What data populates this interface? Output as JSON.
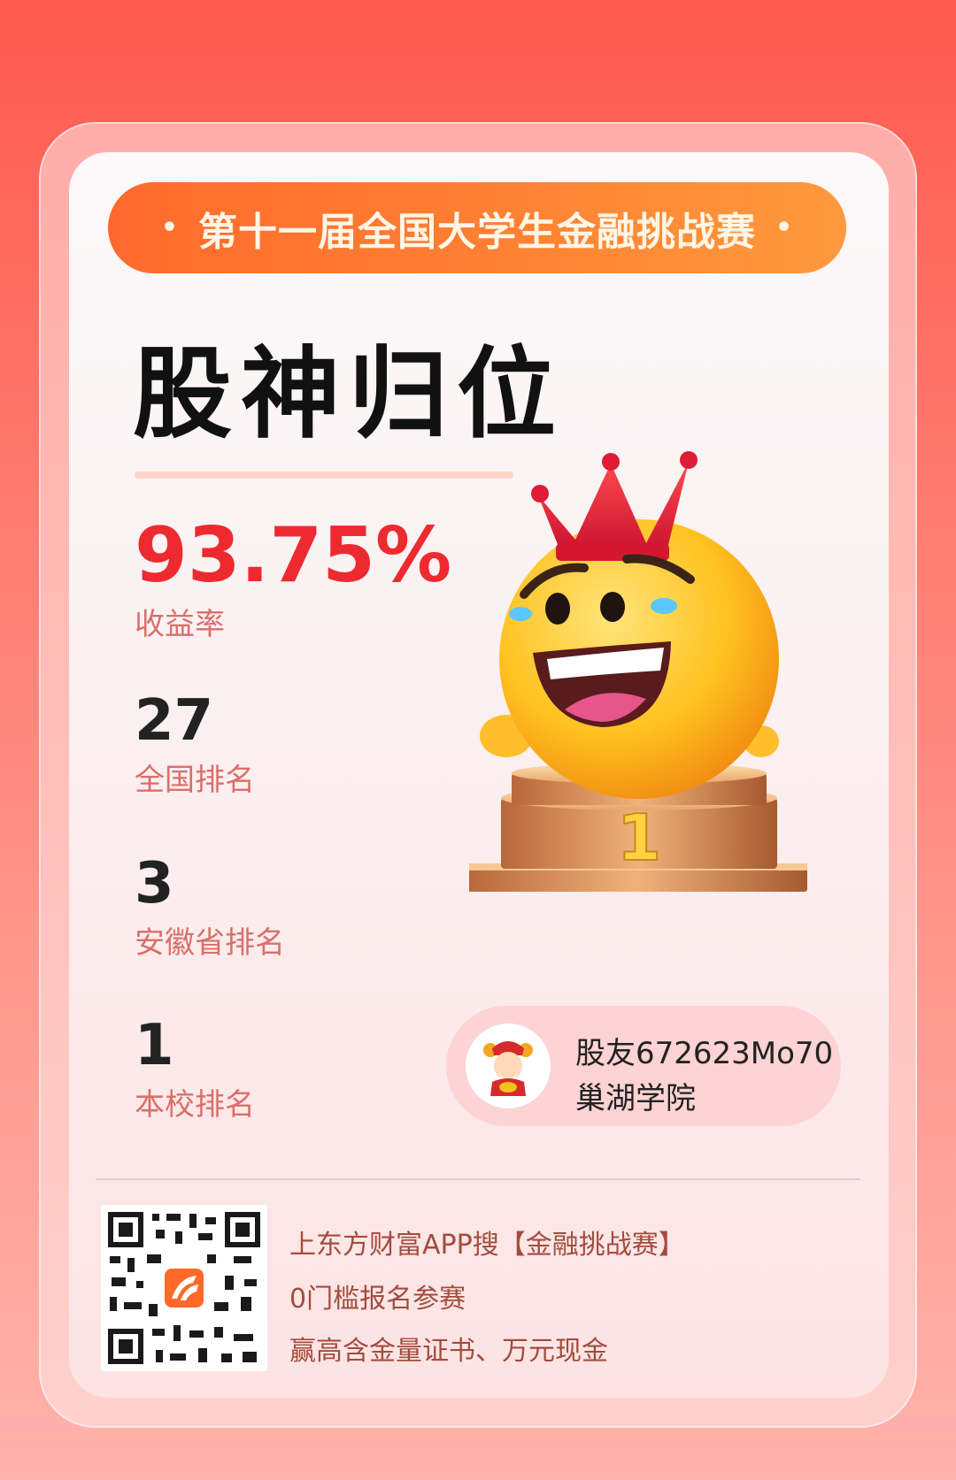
{
  "banner": {
    "dot_left": "•",
    "text": "第十一届全国大学生金融挑战赛",
    "dot_right": "•"
  },
  "title": "股神归位",
  "stats": {
    "yield": {
      "value": "93.75%",
      "label": "收益率"
    },
    "national": {
      "value": "27",
      "label": "全国排名"
    },
    "province": {
      "value": "3",
      "label": "安徽省排名"
    },
    "school": {
      "value": "1",
      "label": "本校排名"
    }
  },
  "podium_label": "1",
  "user": {
    "name": "股友672623Mo70",
    "school": "巢湖学院"
  },
  "promo": {
    "line1": "上东方财富APP搜【金融挑战赛】",
    "line2": "0门槛报名参赛",
    "line3": "赢高含金量证书、万元现金"
  },
  "colors": {
    "accent": "#ee2a31",
    "banner": "#ff7f33",
    "label": "#d96f6b"
  },
  "icons": {
    "mascot": "crowned-emoji-on-podium",
    "avatar": "god-of-wealth-avatar",
    "qr": "qr-code-with-app-logo"
  }
}
